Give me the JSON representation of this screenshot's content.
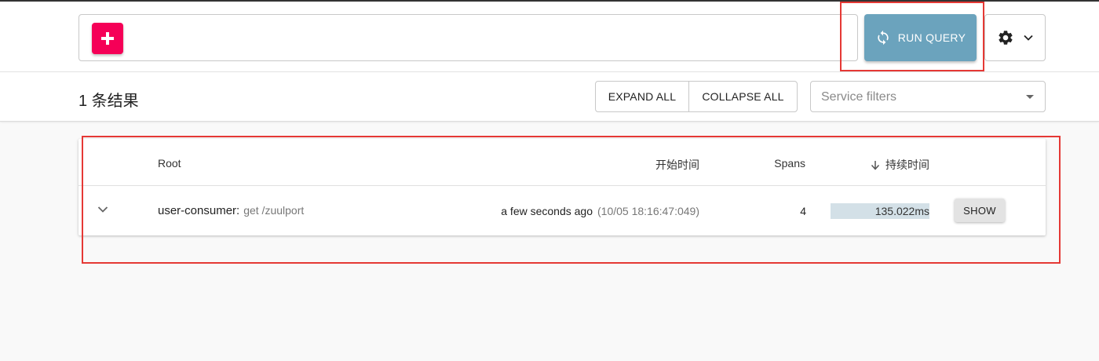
{
  "toolbar": {
    "add_button_icon": "plus-icon",
    "run_query_label": "RUN QUERY",
    "run_query_icon": "refresh-icon",
    "settings_icon": "gear-icon",
    "run_query_color": "#6ba3bd",
    "add_button_color": "#f50057"
  },
  "results": {
    "count_label": "1 条结果",
    "expand_all_label": "EXPAND ALL",
    "collapse_all_label": "COLLAPSE ALL",
    "service_filter_placeholder": "Service filters"
  },
  "table": {
    "headers": {
      "root": "Root",
      "start_time": "开始时间",
      "spans": "Spans",
      "duration": "持续时间"
    },
    "sort_icon": "arrow-down-icon",
    "rows": [
      {
        "service": "user-consumer:",
        "route": "get /zuulport",
        "start_relative": "a few seconds ago",
        "start_absolute": "(10/05 18:16:47:049)",
        "spans": "4",
        "duration": "135.022ms",
        "duration_fraction": 1.0,
        "show_label": "SHOW"
      }
    ]
  },
  "annotations": {
    "highlight_color": "#e53935"
  }
}
